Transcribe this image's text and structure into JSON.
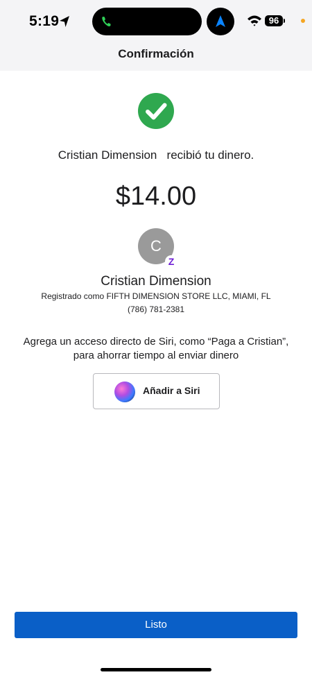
{
  "status_bar": {
    "time": "5:19",
    "battery": "96",
    "icons": [
      "location-arrow-icon",
      "phone-icon",
      "navigation-icon",
      "wifi-icon",
      "battery-icon"
    ],
    "accent_colors": {
      "call": "#30d158",
      "nav": "#0a84ff",
      "privacy_dot": "#f5a623"
    }
  },
  "header": {
    "title": "Confirmación"
  },
  "confirmation": {
    "check_icon": "checkmark-circle-icon",
    "check_color": "#2fa84f",
    "recipient_message": "Cristian Dimension   recibió tu dinero.",
    "amount": "$14.00"
  },
  "recipient": {
    "avatar_initial": "C",
    "badge": "Z",
    "badge_color": "#6d1ed4",
    "name": "Cristian Dimension",
    "registered_as": "Registrado como FIFTH DIMENSION STORE LLC, MIAMI, FL",
    "phone": "(786) 781-2381"
  },
  "siri": {
    "line1": "Agrega un acceso directo de Siri, como “Paga a Cristian”,",
    "line2": "para ahorrar tiempo al enviar dinero",
    "button_label": "Añadir a Siri"
  },
  "footer": {
    "done_label": "Listo",
    "button_color": "#0a5fc7"
  }
}
